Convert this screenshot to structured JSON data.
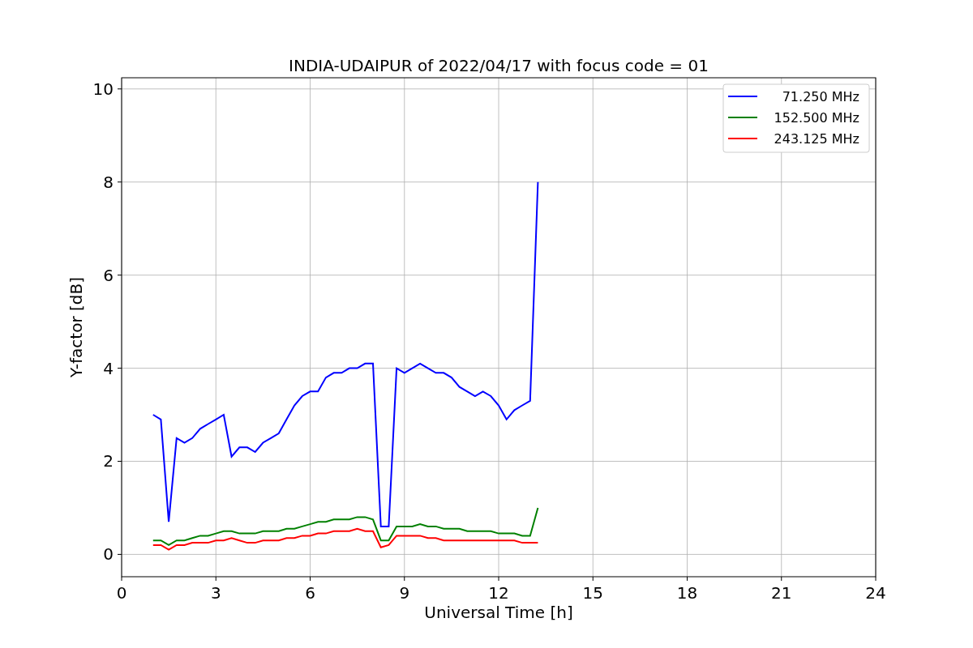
{
  "figure": {
    "chart_data": {
      "type": "line",
      "title": "INDIA-UDAIPUR of 2022/04/17 with focus code = 01",
      "xlabel": "Universal Time [h]",
      "ylabel": "Y-factor [dB]",
      "x": [
        1.0,
        1.25,
        1.5,
        1.75,
        2.0,
        2.25,
        2.5,
        2.75,
        3.0,
        3.25,
        3.5,
        3.75,
        4.0,
        4.25,
        4.5,
        4.75,
        5.0,
        5.25,
        5.5,
        5.75,
        6.0,
        6.25,
        6.5,
        6.75,
        7.0,
        7.25,
        7.5,
        7.75,
        8.0,
        8.25,
        8.5,
        8.75,
        9.0,
        9.25,
        9.5,
        9.75,
        10.0,
        10.25,
        10.5,
        10.75,
        11.0,
        11.25,
        11.5,
        11.75,
        12.0,
        12.25,
        12.5,
        12.75,
        13.0,
        13.25
      ],
      "series": [
        {
          "name": "71.250 MHz",
          "color": "#0000ff",
          "values": [
            3.0,
            2.9,
            0.7,
            2.5,
            2.4,
            2.5,
            2.7,
            2.8,
            2.9,
            3.0,
            2.1,
            2.3,
            2.3,
            2.2,
            2.4,
            2.5,
            2.6,
            2.9,
            3.2,
            3.4,
            3.5,
            3.5,
            3.8,
            3.9,
            3.9,
            4.0,
            4.0,
            4.1,
            4.1,
            0.6,
            0.6,
            4.0,
            3.9,
            4.0,
            4.1,
            4.0,
            3.9,
            3.9,
            3.8,
            3.6,
            3.5,
            3.4,
            3.5,
            3.4,
            3.2,
            2.9,
            3.1,
            3.2,
            3.3,
            8.0
          ]
        },
        {
          "name": "152.500 MHz",
          "color": "#008000",
          "values": [
            0.3,
            0.3,
            0.2,
            0.3,
            0.3,
            0.35,
            0.4,
            0.4,
            0.45,
            0.5,
            0.5,
            0.45,
            0.45,
            0.45,
            0.5,
            0.5,
            0.5,
            0.55,
            0.55,
            0.6,
            0.65,
            0.7,
            0.7,
            0.75,
            0.75,
            0.75,
            0.8,
            0.8,
            0.75,
            0.3,
            0.3,
            0.6,
            0.6,
            0.6,
            0.65,
            0.6,
            0.6,
            0.55,
            0.55,
            0.55,
            0.5,
            0.5,
            0.5,
            0.5,
            0.45,
            0.45,
            0.45,
            0.4,
            0.4,
            1.0
          ]
        },
        {
          "name": "243.125 MHz",
          "color": "#ff0000",
          "values": [
            0.2,
            0.2,
            0.1,
            0.2,
            0.2,
            0.25,
            0.25,
            0.25,
            0.3,
            0.3,
            0.35,
            0.3,
            0.25,
            0.25,
            0.3,
            0.3,
            0.3,
            0.35,
            0.35,
            0.4,
            0.4,
            0.45,
            0.45,
            0.5,
            0.5,
            0.5,
            0.55,
            0.5,
            0.5,
            0.15,
            0.2,
            0.4,
            0.4,
            0.4,
            0.4,
            0.35,
            0.35,
            0.3,
            0.3,
            0.3,
            0.3,
            0.3,
            0.3,
            0.3,
            0.3,
            0.3,
            0.3,
            0.25,
            0.25,
            0.25
          ]
        }
      ],
      "xlim": [
        0,
        24
      ],
      "ylim": [
        -0.48,
        10.24
      ],
      "xticks": [
        0,
        3,
        6,
        9,
        12,
        15,
        18,
        21,
        24
      ],
      "yticks": [
        0,
        2,
        4,
        6,
        8,
        10
      ],
      "grid": true,
      "legend": true
    }
  }
}
